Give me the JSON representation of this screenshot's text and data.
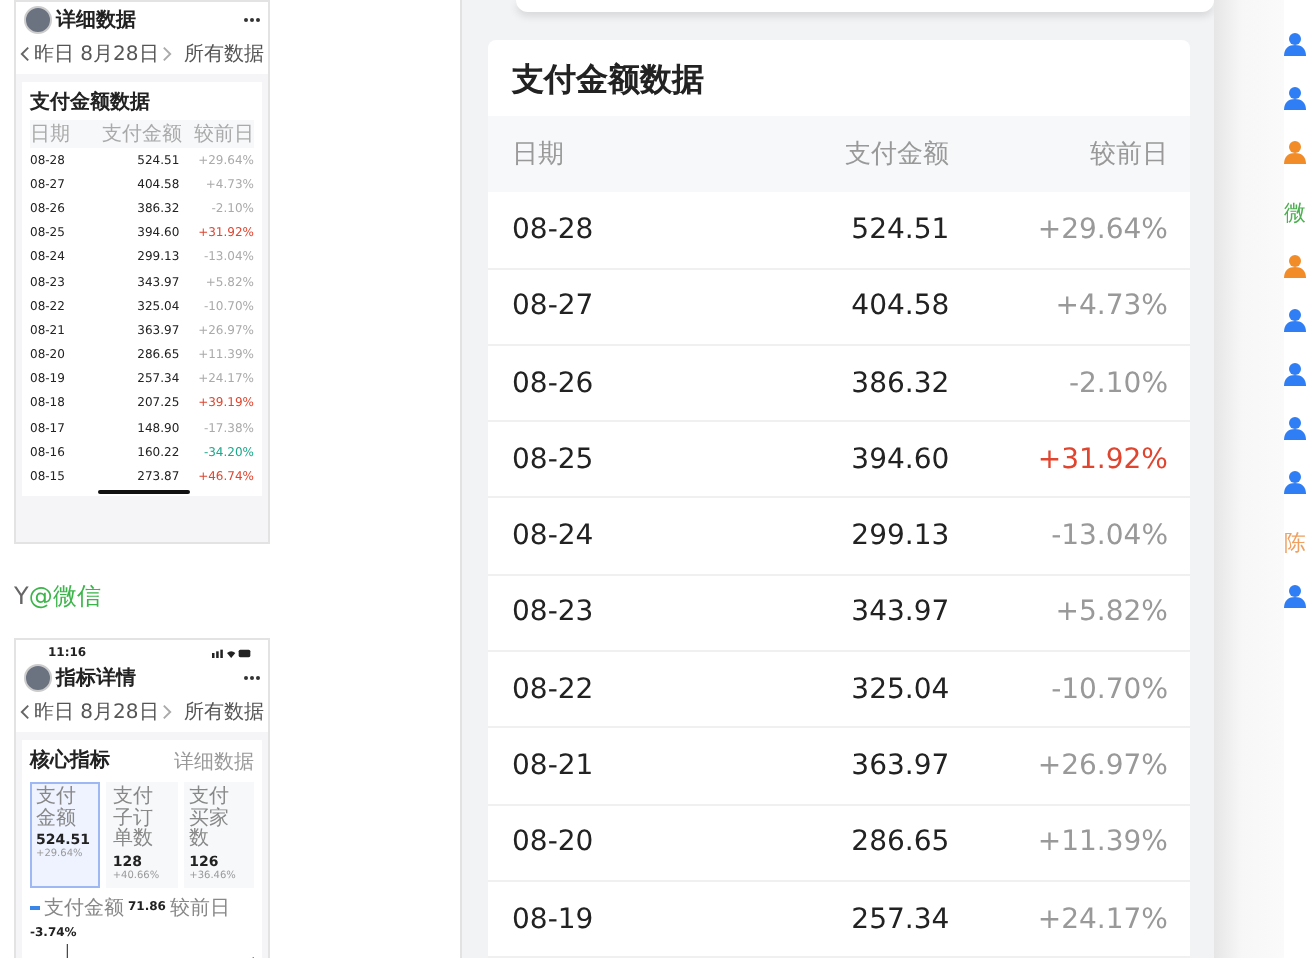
{
  "thumbnail_detail": {
    "title": "详细数据",
    "date": "昨日 8月28日",
    "filter": "所有数据",
    "card_title": "支付金额数据",
    "columns": [
      "日期",
      "支付金额",
      "较前日"
    ],
    "rows": [
      {
        "date": "08-28",
        "amount": "524.51",
        "change": "+29.64%",
        "color": "#aaaaaa"
      },
      {
        "date": "08-27",
        "amount": "404.58",
        "change": "+4.73%",
        "color": "#aaaaaa"
      },
      {
        "date": "08-26",
        "amount": "386.32",
        "change": "-2.10%",
        "color": "#aaaaaa"
      },
      {
        "date": "08-25",
        "amount": "394.60",
        "change": "+31.92%",
        "color": "#e0452f"
      },
      {
        "date": "08-24",
        "amount": "299.13",
        "change": "-13.04%",
        "color": "#aaaaaa"
      },
      {
        "date": "08-23",
        "amount": "343.97",
        "change": "+5.82%",
        "color": "#aaaaaa"
      },
      {
        "date": "08-22",
        "amount": "325.04",
        "change": "-10.70%",
        "color": "#aaaaaa"
      },
      {
        "date": "08-21",
        "amount": "363.97",
        "change": "+26.97%",
        "color": "#aaaaaa"
      },
      {
        "date": "08-20",
        "amount": "286.65",
        "change": "+11.39%",
        "color": "#aaaaaa"
      },
      {
        "date": "08-19",
        "amount": "257.34",
        "change": "+24.17%",
        "color": "#aaaaaa"
      },
      {
        "date": "08-18",
        "amount": "207.25",
        "change": "+39.19%",
        "color": "#e0452f"
      },
      {
        "date": "08-17",
        "amount": "148.90",
        "change": "-17.38%",
        "color": "#aaaaaa"
      },
      {
        "date": "08-16",
        "amount": "160.22",
        "change": "-34.20%",
        "color": "#1aa88a"
      },
      {
        "date": "08-15",
        "amount": "273.87",
        "change": "+46.74%",
        "color": "#e0452f"
      }
    ]
  },
  "source_label": {
    "prefix": "Y",
    "at": "@",
    "name": "微信"
  },
  "thumbnail_metrics": {
    "time": "11:16",
    "title": "指标详情",
    "date": "昨日 8月28日",
    "filter": "所有数据",
    "section_title": "核心指标",
    "details_link": "详细数据",
    "metrics": [
      {
        "label": "支付金额",
        "value": "524.51",
        "change": "+29.64%",
        "selected": true
      },
      {
        "label": "支付子订单数",
        "value": "128",
        "change": "+40.66%",
        "selected": false
      },
      {
        "label": "支付买家数",
        "value": "126",
        "change": "+36.46%",
        "selected": false
      }
    ],
    "legend": {
      "label": "支付金额",
      "value": "71.86",
      "compare_label": "较前日",
      "compare_value": "-3.74%"
    }
  },
  "table": {
    "title": "支付金额数据",
    "columns": [
      "日期",
      "支付金额",
      "较前日"
    ],
    "rows": [
      {
        "date": "08-28",
        "amount": "524.51",
        "change": "+29.64%",
        "color": "#999999"
      },
      {
        "date": "08-27",
        "amount": "404.58",
        "change": "+4.73%",
        "color": "#999999"
      },
      {
        "date": "08-26",
        "amount": "386.32",
        "change": "-2.10%",
        "color": "#999999"
      },
      {
        "date": "08-25",
        "amount": "394.60",
        "change": "+31.92%",
        "color": "#e0452f"
      },
      {
        "date": "08-24",
        "amount": "299.13",
        "change": "-13.04%",
        "color": "#999999"
      },
      {
        "date": "08-23",
        "amount": "343.97",
        "change": "+5.82%",
        "color": "#999999"
      },
      {
        "date": "08-22",
        "amount": "325.04",
        "change": "-10.70%",
        "color": "#999999"
      },
      {
        "date": "08-21",
        "amount": "363.97",
        "change": "+26.97%",
        "color": "#999999"
      },
      {
        "date": "08-20",
        "amount": "286.65",
        "change": "+11.39%",
        "color": "#999999"
      },
      {
        "date": "08-19",
        "amount": "257.34",
        "change": "+24.17%",
        "color": "#999999"
      }
    ]
  },
  "contacts": [
    {
      "kind": "person",
      "color": "#2f7ef5"
    },
    {
      "kind": "person",
      "color": "#2f7ef5"
    },
    {
      "kind": "person",
      "color": "#f28c28"
    },
    {
      "kind": "label",
      "text": "微",
      "color": "#4caf50"
    },
    {
      "kind": "person",
      "color": "#f28c28"
    },
    {
      "kind": "person",
      "color": "#2f7ef5"
    },
    {
      "kind": "person",
      "color": "#2f7ef5"
    },
    {
      "kind": "person",
      "color": "#2f7ef5"
    },
    {
      "kind": "person",
      "color": "#2f7ef5"
    },
    {
      "kind": "label",
      "text": "陈",
      "color": "#f0a060"
    },
    {
      "kind": "person",
      "color": "#2f7ef5"
    }
  ]
}
